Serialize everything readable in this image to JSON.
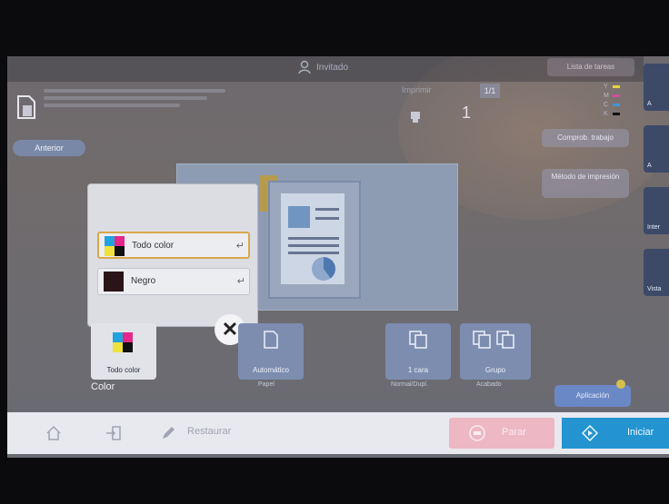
{
  "top": {
    "user_label": "Invitado",
    "right_button": "Lista de tareas"
  },
  "counts": {
    "label": "Imprimir",
    "badge": "1/1",
    "copies": "1",
    "toner_labels": [
      "Y",
      "M",
      "C",
      "K"
    ],
    "toner_colors": [
      "#e6d542",
      "#d34b9d",
      "#3f98d6",
      "#111111"
    ],
    "check_button": "Comprob. trabajo"
  },
  "nav": {
    "previous": "Anterior"
  },
  "right_side": {
    "method_button": "Método de impresión",
    "labels": [
      "A",
      "A",
      "Inter",
      "Vista"
    ]
  },
  "popup": {
    "options": [
      {
        "label": "Todo color",
        "enter": "↵"
      },
      {
        "label": "Negro",
        "enter": "↵"
      }
    ],
    "close_label": "✕"
  },
  "tiles": {
    "color_tile": "Todo color",
    "color_title": "Color",
    "paper_tile": "Automático",
    "paper_sub": "Papel",
    "duplex_tile": "1 cara",
    "duplex_sub": "Normal/Dupl.",
    "finish_tile": "Grupo",
    "finish_sub": "Acabado",
    "apply": "Aplicación"
  },
  "bottom": {
    "restaurar": "Restaurar",
    "parar": "Parar",
    "iniciar": "Iniciar"
  }
}
